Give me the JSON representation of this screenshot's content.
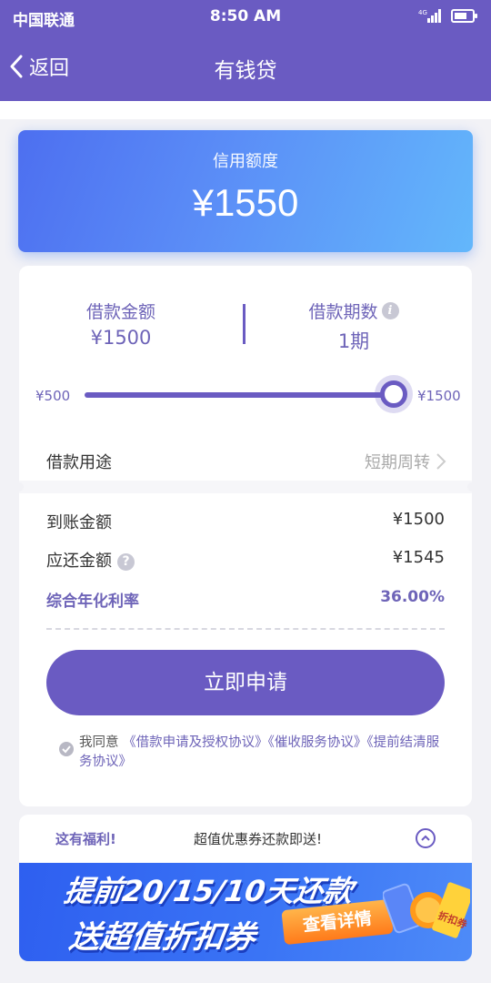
{
  "status_bar": {
    "carrier": "中国联通",
    "time": "8:50 AM",
    "network": "4G"
  },
  "nav": {
    "back_label": "返回",
    "title": "有钱贷"
  },
  "credit": {
    "label": "信用额度",
    "amount": "¥1550"
  },
  "loan": {
    "amount_label": "借款金额",
    "amount_value": "¥1500",
    "period_label": "借款期数",
    "period_value": "1期",
    "slider_min": "¥500",
    "slider_max": "¥1500",
    "slider_fraction": 1.0,
    "purpose_label": "借款用途",
    "purpose_value": "短期周转"
  },
  "summary": {
    "arrive_label": "到账金额",
    "arrive_value": "¥1500",
    "repay_label": "应还金额",
    "repay_value": "¥1545",
    "rate_label": "综合年化利率",
    "rate_value": "36.00%"
  },
  "apply_button": "立即申请",
  "agreement": {
    "prefix": "我同意",
    "link1": "《借款申请及授权协议》",
    "link2": "《催收服务协议》",
    "link3": "《提前结清服务协议》"
  },
  "promo": {
    "left": "这有福利!",
    "middle": "超值优惠券还款即送!",
    "banner_line1": "提前20/15/10天还款",
    "banner_line2": "送超值折扣券",
    "banner_button": "查看详情",
    "coupon_text": "折扣券"
  },
  "colors": {
    "primary": "#6a5bc2",
    "card_gradient_start": "#4d6ff0",
    "card_gradient_end": "#63b7fb",
    "banner_blue": "#2e5ff0",
    "button_orange": "#ff7a1a"
  },
  "icons": [
    "back-chevron-icon",
    "signal-icon",
    "battery-icon",
    "info-icon",
    "chevron-right-icon",
    "help-icon",
    "check-icon",
    "chevron-up-icon"
  ]
}
